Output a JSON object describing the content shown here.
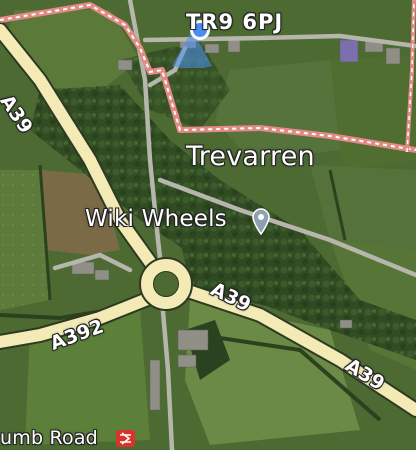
{
  "map": {
    "postcode_label": "TR9 6PJ",
    "place_label": "Trevarren",
    "poi_label": "Wiki Wheels",
    "poi_icon": "location-pin-icon",
    "road_labels": [
      "A39",
      "A39",
      "A39",
      "A392"
    ],
    "station_label": "umb Road",
    "station_icon": "rail-station-icon",
    "location_marker_icon": "current-location-dot-icon",
    "colors": {
      "road_fill": "#f3eab6",
      "boundary": "#e48a86",
      "location_dot": "#4a8ff2",
      "station_badge": "#d9342b"
    }
  }
}
